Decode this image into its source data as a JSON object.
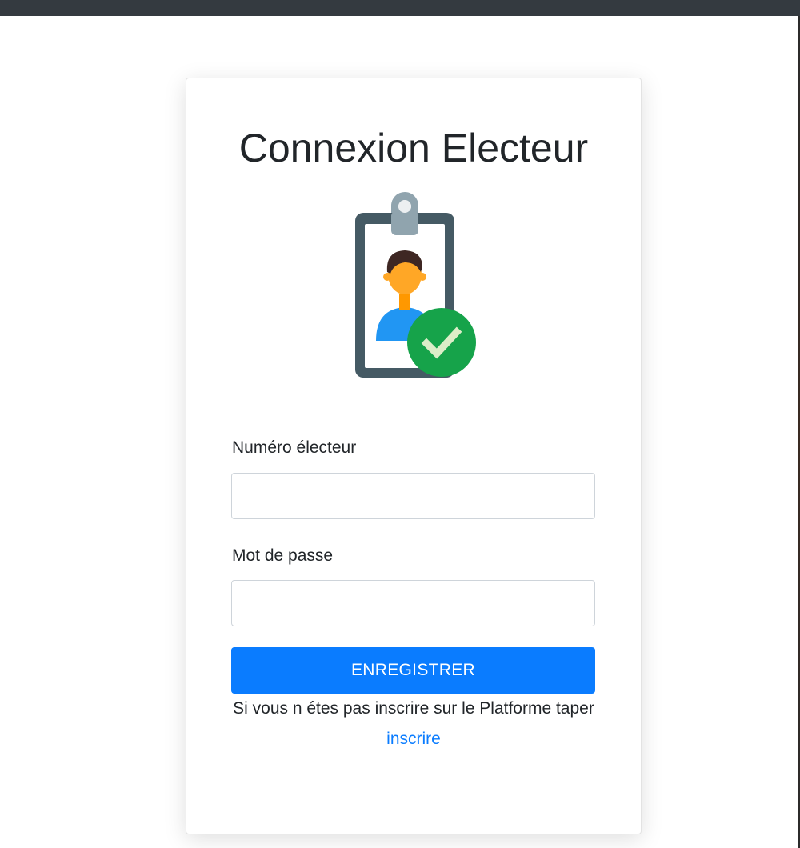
{
  "page": {
    "title": "Connexion Electeur"
  },
  "form": {
    "voter_number_label": "Numéro électeur",
    "voter_number_value": "",
    "password_label": "Mot de passe",
    "password_value": "",
    "submit_label": "ENREGISTRER",
    "register_note": "Si vous n étes pas inscrire sur le Platforme taper",
    "register_link": "inscrire"
  },
  "icons": {
    "badge": "voter-id-badge-icon",
    "check": "checkmark-icon"
  },
  "colors": {
    "topbar": "#343a40",
    "primary": "#0a7cff",
    "check_green": "#16a34a",
    "badge_frame": "#455a64"
  }
}
